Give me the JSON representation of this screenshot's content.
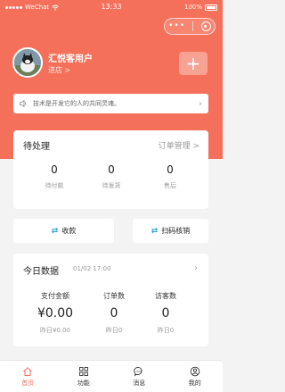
{
  "status_bar": {
    "carrier": "WeChat",
    "time": "13:33",
    "battery": "100%"
  },
  "header": {
    "user_name": "汇悦客用户",
    "enter_label": "进店 >"
  },
  "notice": {
    "text": "技术是开发它的人的共同灵魂。"
  },
  "pending": {
    "title": "待处理",
    "manage_link": "订单管理 >",
    "items": [
      {
        "value": "0",
        "label": "待付款"
      },
      {
        "value": "0",
        "label": "待发货"
      },
      {
        "value": "0",
        "label": "售后"
      }
    ]
  },
  "actions": {
    "collect_label": "收款",
    "scan_label": "扫码核销"
  },
  "today": {
    "title": "今日数据",
    "date": "01/02 17:00",
    "metrics": [
      {
        "label": "支付金额",
        "value": "¥0.00",
        "yesterday": "昨日¥0.00"
      },
      {
        "label": "订单数",
        "value": "0",
        "yesterday": "昨日0"
      },
      {
        "label": "访客数",
        "value": "0",
        "yesterday": "昨日0"
      }
    ]
  },
  "tabbar": [
    {
      "label": "首页",
      "icon": "home-icon",
      "active": true
    },
    {
      "label": "功能",
      "icon": "grid-icon",
      "active": false
    },
    {
      "label": "消息",
      "icon": "message-icon",
      "active": false
    },
    {
      "label": "我的",
      "icon": "user-icon",
      "active": false
    }
  ],
  "colors": {
    "brand": "#f5705a",
    "accent_icon": "#2aa4d0",
    "background": "#f3f3f3"
  }
}
